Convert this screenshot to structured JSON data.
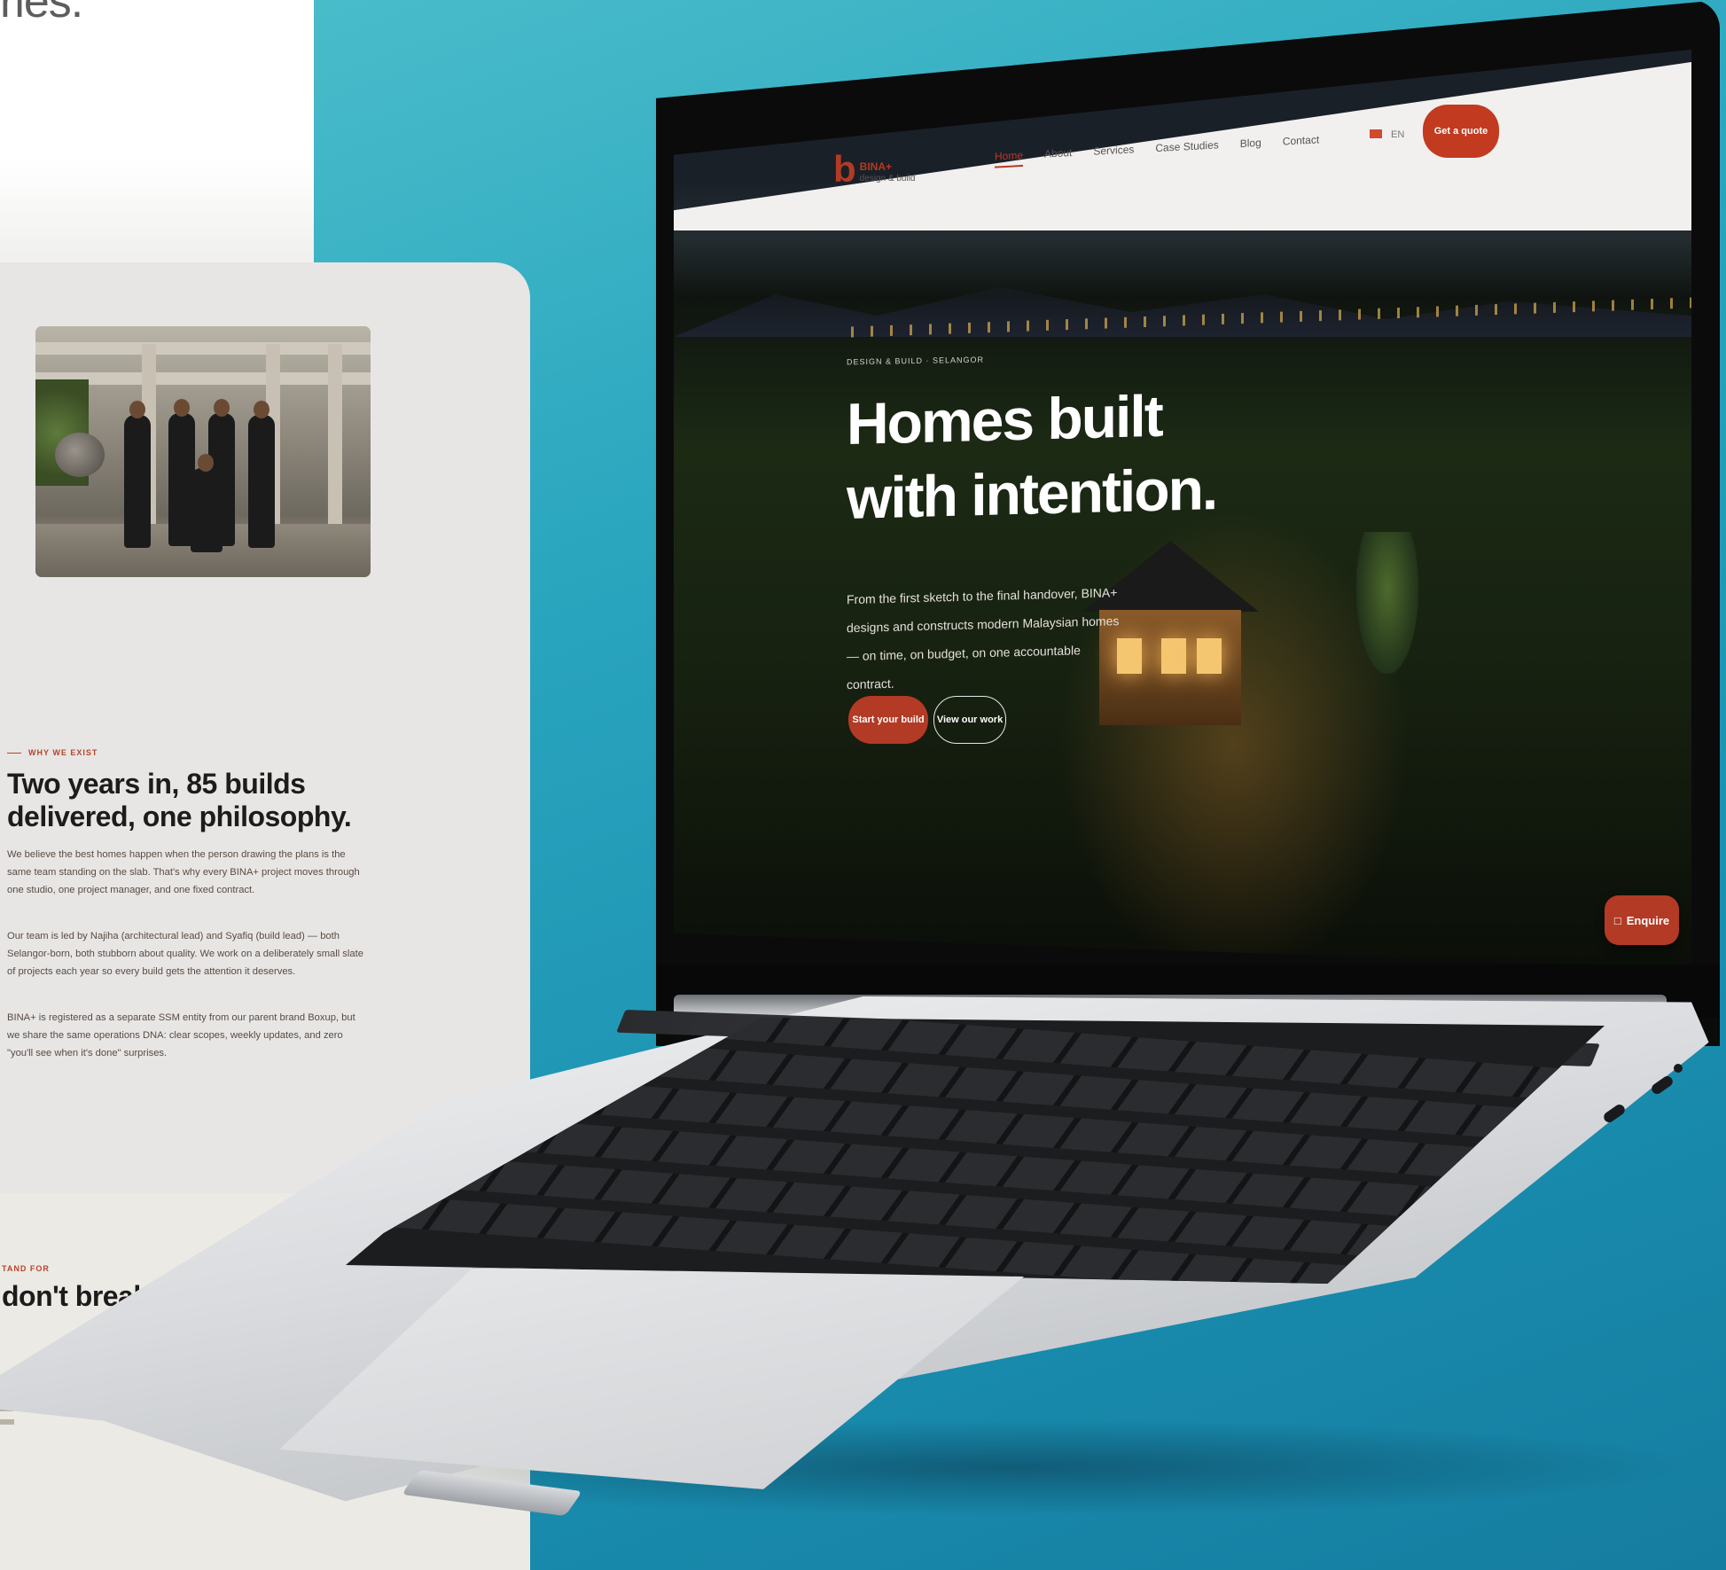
{
  "left_site": {
    "top_fragment": "ries.",
    "about": {
      "eyebrow": "WHY WE EXIST",
      "headline": "Two years in, 85 builds delivered, one philosophy.",
      "paragraphs": [
        "We believe the best homes happen when the person drawing the plans is the same team standing on the slab. That's why every BINA+ project moves through one studio, one project manager, and one fixed contract.",
        "Our team is led by Najiha (architectural lead) and Syafiq (build lead) — both Selangor-born, both stubborn about quality. We work on a deliberately small slate of projects each year so every build gets the attention it deserves.",
        "BINA+ is registered as a separate SSM entity from our parent brand Boxup, but we share the same operations DNA: clear scopes, weekly updates, and zero \"you'll see when it's done\" surprises."
      ]
    },
    "values": {
      "eyebrow": "TAND FOR",
      "headline": "don't break."
    }
  },
  "laptop_site": {
    "logo": {
      "mark": "b",
      "name": "BINA+",
      "tagline": "design & build"
    },
    "nav": [
      "Home",
      "About",
      "Services",
      "Case Studies",
      "Blog",
      "Contact"
    ],
    "active_nav": "Home",
    "lang": "EN",
    "cta": "Get a quote",
    "hero": {
      "eyebrow": "DESIGN & BUILD · SELANGOR",
      "title_line1": "Homes built",
      "title_line2": "with intention.",
      "subtitle": "From the first sketch to the final handover, BINA+ designs and constructs modern Malaysian homes — on time, on budget, on one accountable contract.",
      "primary_cta": "Start your build",
      "secondary_cta": "View our work"
    },
    "enquire": "Enquire"
  },
  "colors": {
    "brand_red": "#b33a24",
    "background_teal": "#2aa6bf",
    "card_bg": "#e7e6e4"
  }
}
